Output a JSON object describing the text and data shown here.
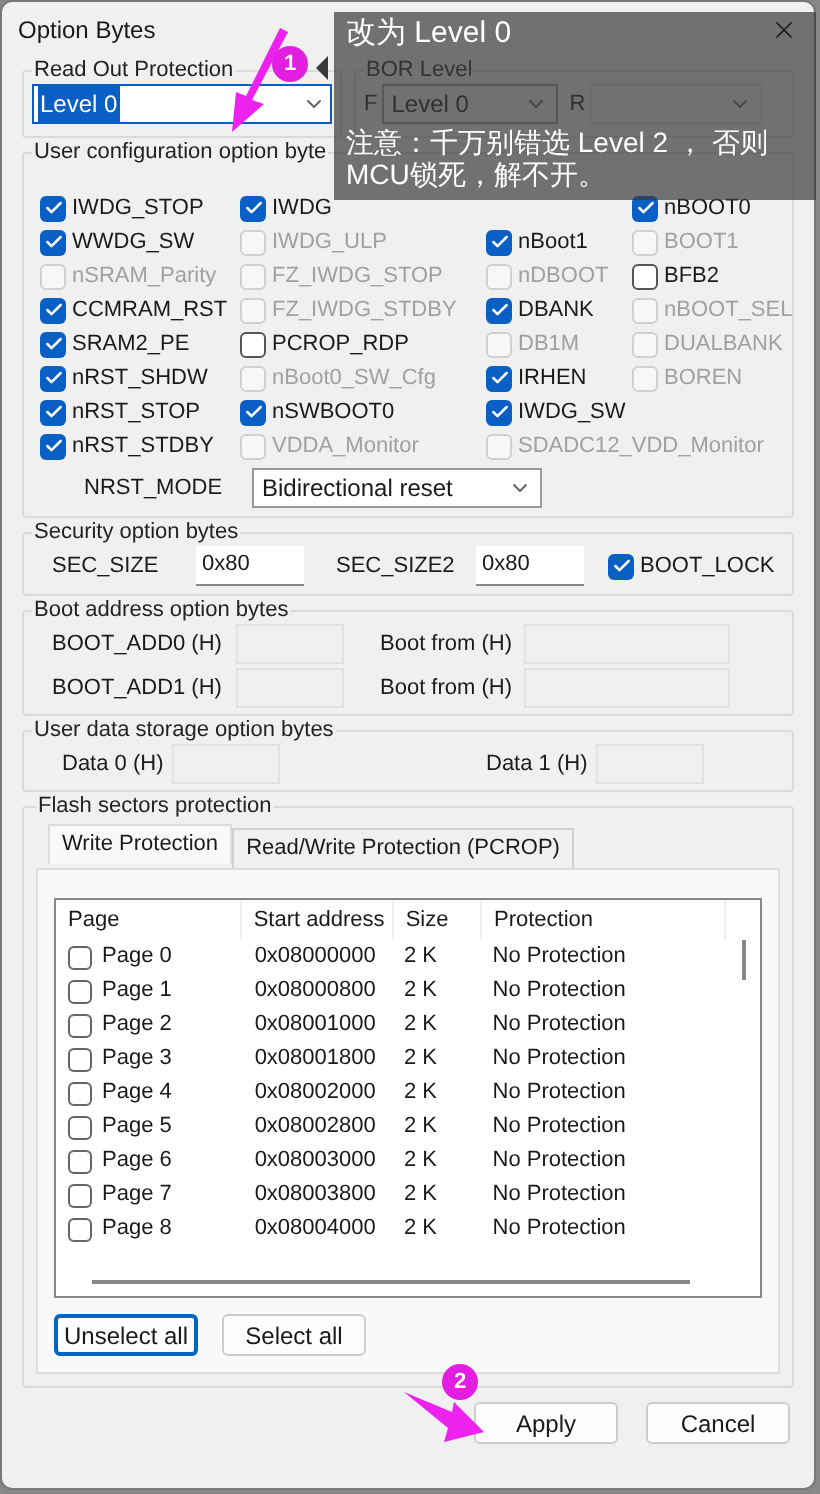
{
  "window": {
    "title": "Option Bytes"
  },
  "read_out_protection": {
    "title": "Read Out Protection",
    "value": "Level 0"
  },
  "bor_level": {
    "title": "BOR Level",
    "f_label": "F",
    "f_value": "Level 0",
    "r_label": "R"
  },
  "user_config": {
    "title": "User configuration option byte",
    "options": [
      {
        "kind": "checkbox",
        "label": "IWDG_STOP",
        "checked": true,
        "disabled": false
      },
      {
        "kind": "checkbox",
        "label": "IWDG",
        "checked": true,
        "disabled": false
      },
      {
        "kind": "covered"
      },
      {
        "kind": "checkbox",
        "label": "nBOOT0",
        "checked": true,
        "disabled": false
      },
      {
        "kind": "checkbox",
        "label": "WWDG_SW",
        "checked": true,
        "disabled": false
      },
      {
        "kind": "checkbox",
        "label": "IWDG_ULP",
        "checked": false,
        "disabled": true
      },
      {
        "kind": "checkbox",
        "label": "nBoot1",
        "checked": true,
        "disabled": false
      },
      {
        "kind": "checkbox",
        "label": "BOOT1",
        "checked": false,
        "disabled": true
      },
      {
        "kind": "checkbox",
        "label": "nSRAM_Parity",
        "checked": false,
        "disabled": true
      },
      {
        "kind": "checkbox",
        "label": "FZ_IWDG_STOP",
        "checked": false,
        "disabled": true
      },
      {
        "kind": "checkbox",
        "label": "nDBOOT",
        "checked": false,
        "disabled": true
      },
      {
        "kind": "checkbox",
        "label": "BFB2",
        "checked": false,
        "disabled": false
      },
      {
        "kind": "checkbox",
        "label": "CCMRAM_RST",
        "checked": true,
        "disabled": false
      },
      {
        "kind": "checkbox",
        "label": "FZ_IWDG_STDBY",
        "checked": false,
        "disabled": true
      },
      {
        "kind": "checkbox",
        "label": "DBANK",
        "checked": true,
        "disabled": false
      },
      {
        "kind": "checkbox",
        "label": "nBOOT_SEL",
        "checked": false,
        "disabled": true
      },
      {
        "kind": "checkbox",
        "label": "SRAM2_PE",
        "checked": true,
        "disabled": false
      },
      {
        "kind": "checkbox",
        "label": "PCROP_RDP",
        "checked": false,
        "disabled": false
      },
      {
        "kind": "checkbox",
        "label": "DB1M",
        "checked": false,
        "disabled": true
      },
      {
        "kind": "checkbox",
        "label": "DUALBANK",
        "checked": false,
        "disabled": true
      },
      {
        "kind": "checkbox",
        "label": "nRST_SHDW",
        "checked": true,
        "disabled": false
      },
      {
        "kind": "checkbox",
        "label": "nBoot0_SW_Cfg",
        "checked": false,
        "disabled": true
      },
      {
        "kind": "checkbox",
        "label": "IRHEN",
        "checked": true,
        "disabled": false
      },
      {
        "kind": "checkbox",
        "label": "BOREN",
        "checked": false,
        "disabled": true
      },
      {
        "kind": "checkbox",
        "label": "nRST_STOP",
        "checked": true,
        "disabled": false
      },
      {
        "kind": "checkbox",
        "label": "nSWBOOT0",
        "checked": true,
        "disabled": false
      },
      {
        "kind": "checkbox",
        "label": "IWDG_SW",
        "checked": true,
        "disabled": false
      },
      {
        "kind": "empty"
      },
      {
        "kind": "checkbox",
        "label": "nRST_STDBY",
        "checked": true,
        "disabled": false
      },
      {
        "kind": "checkbox",
        "label": "VDDA_Monitor",
        "checked": false,
        "disabled": true
      },
      {
        "kind": "checkbox",
        "label": "SDADC12_VDD_Monitor",
        "checked": false,
        "disabled": true
      }
    ],
    "nrst_mode": {
      "label": "NRST_MODE",
      "value": "Bidirectional reset"
    }
  },
  "security": {
    "title": "Security option bytes",
    "sec_size": {
      "label": "SEC_SIZE",
      "value": "0x80"
    },
    "sec_size2": {
      "label": "SEC_SIZE2",
      "value": "0x80"
    },
    "boot_lock": {
      "label": "BOOT_LOCK",
      "checked": true
    }
  },
  "boot_address": {
    "title": "Boot address option bytes",
    "rows": [
      {
        "label": "BOOT_ADD0 (H)",
        "from_label": "Boot from (H)"
      },
      {
        "label": "BOOT_ADD1 (H)",
        "from_label": "Boot from (H)"
      }
    ]
  },
  "user_data": {
    "title": "User data storage option bytes",
    "fields": [
      {
        "label": "Data 0 (H)"
      },
      {
        "label": "Data 1 (H)"
      }
    ]
  },
  "flash_protection": {
    "title": "Flash sectors protection",
    "tabs": [
      {
        "label": "Write Protection",
        "selected": true
      },
      {
        "label": "Read/Write Protection (PCROP)",
        "selected": false
      }
    ],
    "columns": [
      "Page",
      "Start address",
      "Size",
      "Protection"
    ],
    "rows": [
      {
        "page": "Page 0",
        "start": "0x08000000",
        "size": "2 K",
        "protection": "No Protection",
        "checked": false
      },
      {
        "page": "Page 1",
        "start": "0x08000800",
        "size": "2 K",
        "protection": "No Protection",
        "checked": false
      },
      {
        "page": "Page 2",
        "start": "0x08001000",
        "size": "2 K",
        "protection": "No Protection",
        "checked": false
      },
      {
        "page": "Page 3",
        "start": "0x08001800",
        "size": "2 K",
        "protection": "No Protection",
        "checked": false
      },
      {
        "page": "Page 4",
        "start": "0x08002000",
        "size": "2 K",
        "protection": "No Protection",
        "checked": false
      },
      {
        "page": "Page 5",
        "start": "0x08002800",
        "size": "2 K",
        "protection": "No Protection",
        "checked": false
      },
      {
        "page": "Page 6",
        "start": "0x08003000",
        "size": "2 K",
        "protection": "No Protection",
        "checked": false
      },
      {
        "page": "Page 7",
        "start": "0x08003800",
        "size": "2 K",
        "protection": "No Protection",
        "checked": false
      },
      {
        "page": "Page 8",
        "start": "0x08004000",
        "size": "2 K",
        "protection": "No Protection",
        "checked": false
      }
    ],
    "buttons": [
      {
        "label": "Unselect all",
        "focused": true
      },
      {
        "label": "Select all",
        "focused": false
      }
    ]
  },
  "buttons": [
    "Apply",
    "Cancel"
  ],
  "annotations": [
    {
      "number": "1",
      "text": "改为 Level 0",
      "note": "注意：千万别错选 Level 2 ， 否则MCU锁死，解不开。"
    },
    {
      "number": "2"
    }
  ]
}
